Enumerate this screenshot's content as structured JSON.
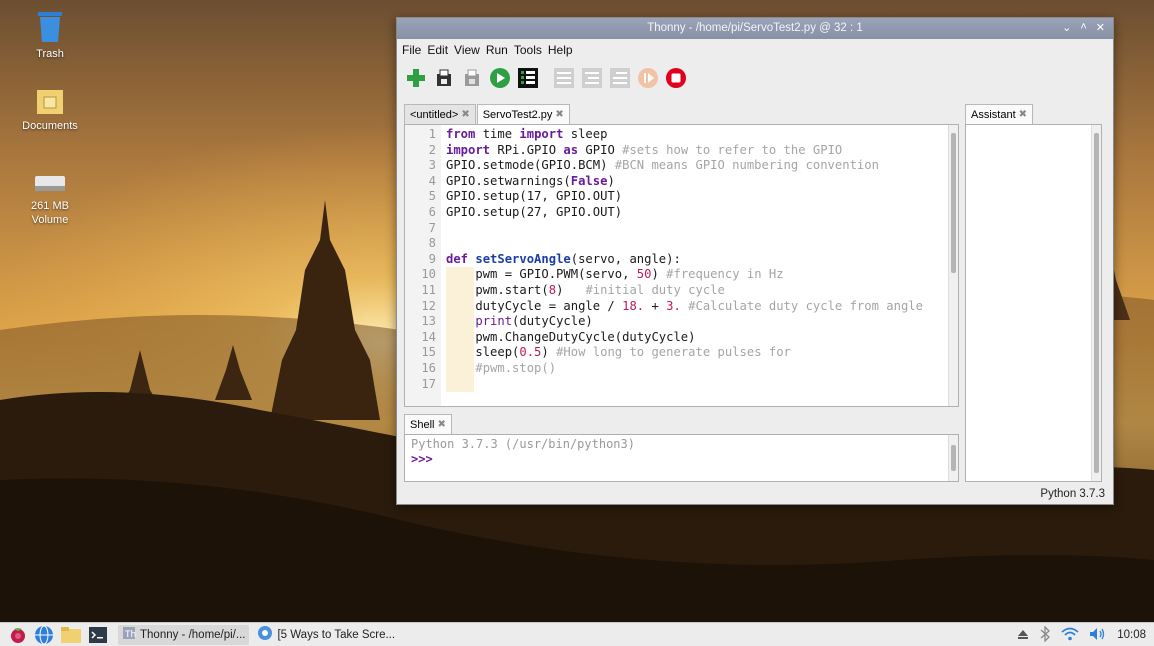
{
  "desktop": {
    "icons": [
      {
        "label": "Trash",
        "icon": "trash-icon"
      },
      {
        "label": "Documents",
        "icon": "folder-icon"
      },
      {
        "label": "261 MB Volume",
        "icon": "drive-icon"
      }
    ]
  },
  "window": {
    "title": "Thonny  -  /home/pi/ServoTest2.py  @  32 : 1",
    "controls": [
      "⌄",
      "˄",
      "✕"
    ],
    "menu": [
      "File",
      "Edit",
      "View",
      "Run",
      "Tools",
      "Help"
    ],
    "toolbar": [
      "new-file-icon",
      "open-file-icon",
      "save-file-icon",
      "run-icon",
      "debug-icon",
      "step-over-icon",
      "step-into-icon",
      "step-out-icon",
      "resume-icon",
      "stop-icon"
    ],
    "colors": {
      "run": "#2ea043",
      "stop": "#e0001b",
      "new": "#2ea043"
    }
  },
  "editor": {
    "tabs": [
      "<untitled>",
      "ServoTest2.py"
    ],
    "line_numbers": [
      "1",
      "2",
      "3",
      "4",
      "5",
      "6",
      "7",
      "8",
      "9",
      "10",
      "11",
      "12",
      "13",
      "14",
      "15",
      "16",
      "17"
    ]
  },
  "shell": {
    "tab": "Shell",
    "banner": "Python 3.7.3 (/usr/bin/python3)",
    "prompt": ">>>"
  },
  "assistant": {
    "tab": "Assistant"
  },
  "status": {
    "interpreter": "Python 3.7.3"
  },
  "taskbar": {
    "tasks": [
      "Thonny  -  /home/pi/...",
      "[5 Ways to Take Scre..."
    ],
    "clock": "10:08"
  }
}
